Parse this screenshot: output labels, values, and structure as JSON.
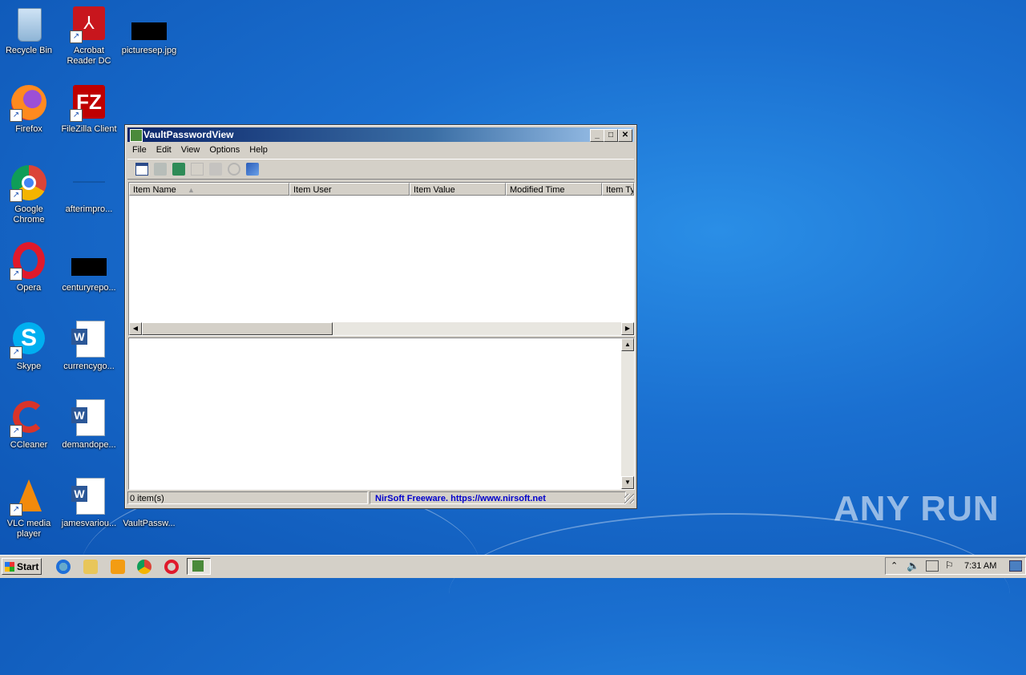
{
  "desktop": {
    "icons": [
      {
        "label": "Recycle Bin",
        "icon": "recycle-bin-icon"
      },
      {
        "label": "Acrobat Reader DC",
        "icon": "acrobat-icon"
      },
      {
        "label": "picturesep.jpg",
        "icon": "image-file-icon"
      },
      {
        "label": "Firefox",
        "icon": "firefox-icon"
      },
      {
        "label": "FileZilla Client",
        "icon": "filezilla-icon"
      },
      {
        "label": "Google Chrome",
        "icon": "chrome-icon"
      },
      {
        "label": "afterimpro...",
        "icon": "file-icon"
      },
      {
        "label": "Opera",
        "icon": "opera-icon"
      },
      {
        "label": "centuryrepo...",
        "icon": "file-icon"
      },
      {
        "label": "Skype",
        "icon": "skype-icon"
      },
      {
        "label": "currencygo...",
        "icon": "word-doc-icon"
      },
      {
        "label": "CCleaner",
        "icon": "ccleaner-icon"
      },
      {
        "label": "demandope...",
        "icon": "word-doc-icon"
      },
      {
        "label": "VLC media player",
        "icon": "vlc-icon"
      },
      {
        "label": "jamesvariou...",
        "icon": "word-doc-icon"
      },
      {
        "label": "VaultPassw...",
        "icon": "vaultpasswordview-icon"
      }
    ]
  },
  "window": {
    "title": "VaultPasswordView",
    "menu": [
      "File",
      "Edit",
      "View",
      "Options",
      "Help"
    ],
    "columns": [
      "Item Name",
      "Item User",
      "Item Value",
      "Modified Time",
      "Item Ty"
    ],
    "sort_indicator": "▲",
    "status_count": "0 item(s)",
    "status_link": "NirSoft Freeware. https://www.nirsoft.net"
  },
  "taskbar": {
    "start_label": "Start",
    "clock": "7:31 AM"
  },
  "watermark": "ANY RUN",
  "colors": {
    "link": "#0000cc",
    "title_start": "#0a246a"
  }
}
